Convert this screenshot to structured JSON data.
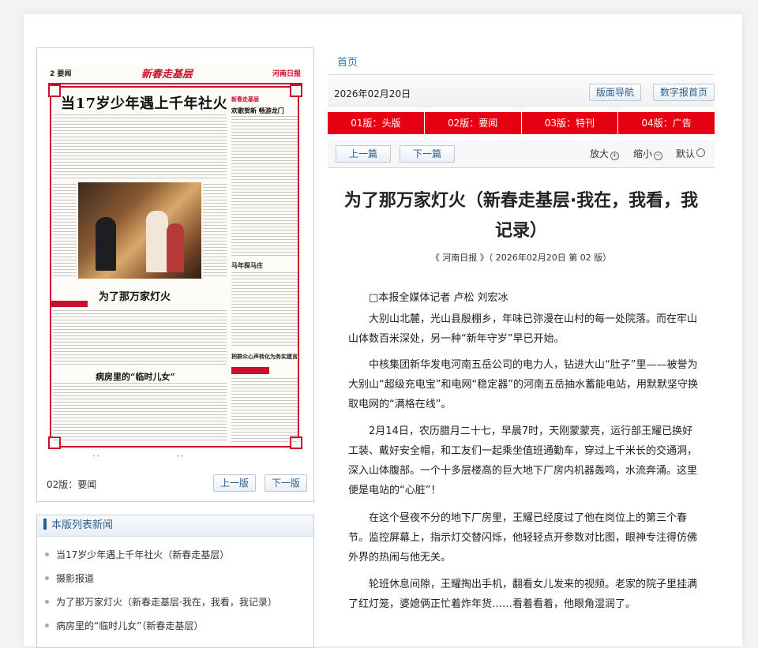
{
  "paper": {
    "page_number": "2 要闻",
    "banner": "新春走基层",
    "brand": "河南日报",
    "headline_main": "当17岁少年遇上千年社火",
    "headline_middle": "为了那万家灯火",
    "headline_bottom": "病房里的“临时儿女”",
    "side_heading_1": "欢歌贺新 畅游龙门",
    "side_heading_2": "马年探马庄",
    "side_heading_3": "把群众心声转化为务实建言",
    "page_label": "02版：要闻",
    "prev_page": "上一版",
    "next_page": "下一版",
    "dots": "• •"
  },
  "list": {
    "title": "本版列表新闻",
    "items": [
      "当17岁少年遇上千年社火（新春走基层）",
      "摄影报道",
      "为了那万家灯火（新春走基层·我在，我看，我记录）",
      "病房里的“临时儿女”（新春走基层）"
    ]
  },
  "header": {
    "breadcrumb": "首页",
    "date": "2026年02月20日",
    "layout_nav": "版面导航",
    "digital_home": "数字报首页"
  },
  "tabs": [
    "01版：头版",
    "02版：要闻",
    "03版：特刊",
    "04版：广告"
  ],
  "nav": {
    "prev_article": "上一篇",
    "next_article": "下一篇",
    "zoom_in": "放大",
    "zoom_out": "缩小",
    "default": "默认"
  },
  "article": {
    "title": "为了那万家灯火（新春走基层·我在，我看，我记录）",
    "source": "《 河南日报 》（ 2026年02月20日 第 02 版）",
    "byline": "□本报全媒体记者 卢松 刘宏冰",
    "paragraphs": [
      "大别山北麓，光山县殷棚乡，年味已弥漫在山村的每一处院落。而在牢山山体数百米深处，另一种“新年守岁”早已开始。",
      "中核集团新华发电河南五岳公司的电力人，钻进大山“肚子”里——被誉为大别山“超级充电宝”和电网“稳定器”的河南五岳抽水蓄能电站，用默默坚守换取电网的“满格在线”。",
      "2月14日，农历腊月二十七，早晨7时，天刚蒙蒙亮，运行部王耀已换好工装、戴好安全帽，和工友们一起乘坐值班通勤车，穿过上千米长的交通洞，深入山体腹部。一个十多层楼高的巨大地下厂房内机器轰鸣，水流奔涌。这里便是电站的“心脏”！",
      "在这个昼夜不分的地下厂房里，王耀已经度过了他在岗位上的第三个春节。监控屏幕上，指示灯交替闪烁，他轻轻点开参数对比图，眼神专注得仿佛外界的热闹与他无关。",
      "轮班休息间隙，王耀掏出手机，翻看女儿发来的视频。老家的院子里挂满了红灯笼，婆媳俩正忙着炸年货……看着看着，他眼角湿润了。"
    ]
  },
  "colors": {
    "accent_red": "#e50012",
    "link_blue": "#3a78b5",
    "paper_red": "#c8102e"
  },
  "icons": {
    "zoom_in": "plus-circle-icon",
    "zoom_out": "minus-circle-icon",
    "default": "circle-icon"
  }
}
